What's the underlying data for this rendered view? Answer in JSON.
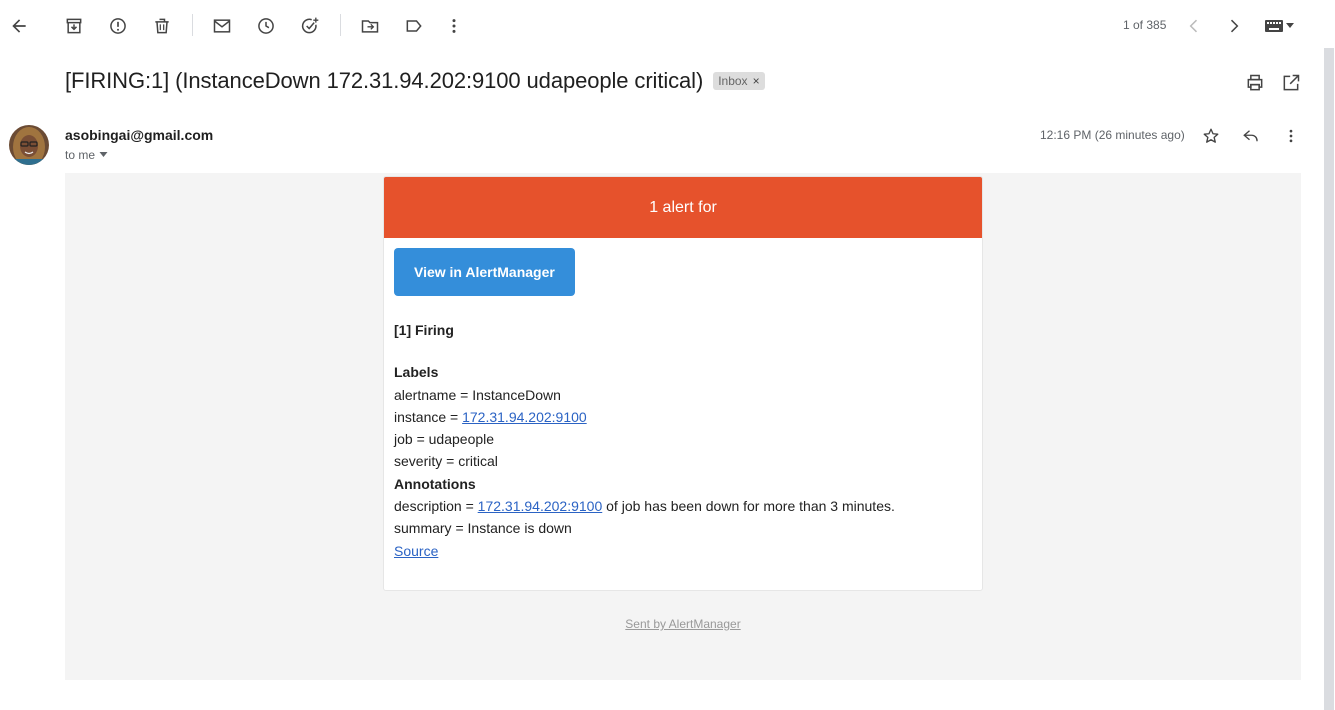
{
  "toolbar": {
    "back_icon": "arrow-left-icon",
    "archive_icon": "archive-icon",
    "spam_icon": "report-spam-icon",
    "delete_icon": "trash-icon",
    "unread_icon": "mail-icon",
    "snooze_icon": "clock-icon",
    "task_icon": "add-task-icon",
    "move_icon": "move-to-folder-icon",
    "label_icon": "label-icon",
    "more_icon": "more-vert-icon",
    "pager": "1 of 385",
    "prev_icon": "chevron-left-icon",
    "next_icon": "chevron-right-icon",
    "keyboard_icon": "keyboard-icon"
  },
  "email": {
    "subject": "[FIRING:1] (InstanceDown 172.31.94.202:9100 udapeople critical)",
    "label": "Inbox",
    "label_remove": "×",
    "sender": "asobingai@gmail.com",
    "to": "to me",
    "time": "12:16 PM (26 minutes ago)"
  },
  "alert": {
    "header": "1 alert for",
    "button": "View in AlertManager",
    "firing": "[1] Firing",
    "labels_heading": "Labels",
    "alertname": "alertname = InstanceDown",
    "instance_prefix": "instance = ",
    "instance_link": "172.31.94.202:9100",
    "job": "job = udapeople",
    "severity": "severity = critical",
    "annotations_heading": "Annotations",
    "description_prefix": "description = ",
    "description_link": "172.31.94.202:9100",
    "description_suffix": " of job has been down for more than 3 minutes.",
    "summary": "summary = Instance is down",
    "source": "Source",
    "footer": "Sent by AlertManager"
  },
  "colors": {
    "alert_header": "#e6522c",
    "button": "#348eda",
    "link": "#2b63c4",
    "body_bg": "#f4f4f4"
  }
}
